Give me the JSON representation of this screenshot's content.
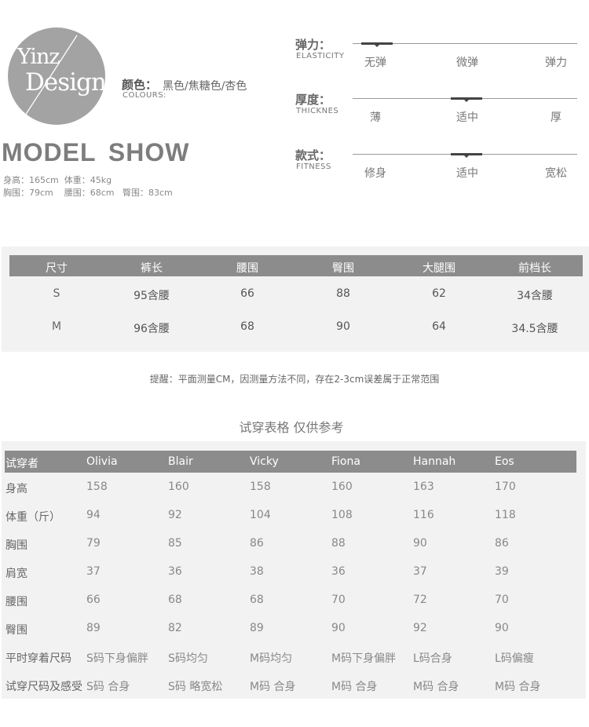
{
  "logo": {
    "line1": "Yinz",
    "line2": "Design"
  },
  "colours": {
    "label": "颜色：",
    "value": "黑色/焦糖色/杏色",
    "label_en": "COLOURS:"
  },
  "model": {
    "title": "MODEL  SHOW",
    "line1": "身高：165cm  体重：45kg",
    "line2": "胸围：79cm    腰围：68cm   臀围：83cm"
  },
  "scales": [
    {
      "label": "弹力：",
      "label_en": "ELASTICITY",
      "options": [
        "无弹",
        "微弹",
        "弹力"
      ],
      "selected_index": 0
    },
    {
      "label": "厚度：",
      "label_en": "THICKNES",
      "options": [
        "薄",
        "适中",
        "厚"
      ],
      "selected_index": 1
    },
    {
      "label": "款式：",
      "label_en": "FITNESS",
      "options": [
        "修身",
        "适中",
        "宽松"
      ],
      "selected_index": 1
    }
  ],
  "size_table": {
    "headers": [
      "尺寸",
      "裤长",
      "腰围",
      "臀围",
      "大腿围",
      "前档长"
    ],
    "rows": [
      [
        "S",
        "95含腰",
        "66",
        "88",
        "62",
        "34含腰"
      ],
      [
        "M",
        "96含腰",
        "68",
        "90",
        "64",
        "34.5含腰"
      ]
    ]
  },
  "note": "提醒：平面测量CM，因测量方法不同，存在2-3cm误差属于正常范围",
  "try_table": {
    "title": "试穿表格 仅供参考",
    "headers": [
      "试穿者",
      "Olivia",
      "Blair",
      "Vicky",
      "Fiona",
      "Hannah",
      "Eos"
    ],
    "rows": [
      [
        "身高",
        "158",
        "160",
        "158",
        "160",
        "163",
        "170"
      ],
      [
        "体重（斤）",
        "94",
        "92",
        "104",
        "108",
        "116",
        "118"
      ],
      [
        "胸围",
        "79",
        "85",
        "86",
        "88",
        "90",
        "86"
      ],
      [
        "肩宽",
        "37",
        "36",
        "38",
        "36",
        "37",
        "39"
      ],
      [
        "腰围",
        "66",
        "68",
        "68",
        "70",
        "72",
        "70"
      ],
      [
        "臀围",
        "89",
        "82",
        "89",
        "90",
        "92",
        "90"
      ],
      [
        "平时穿着尺码",
        "S码下身偏胖",
        "S码均匀",
        "M码均匀",
        "M码下身偏胖",
        "L码合身",
        "L码偏瘦"
      ],
      [
        "试穿尺码及感受",
        "S码 合身",
        "S码 略宽松",
        "M码 合身",
        "M码 合身",
        "M码 合身",
        "M码 合身"
      ]
    ]
  },
  "colors": {
    "header_bg": "#8c8c8c",
    "table_bg": "#f2f2f2",
    "logo_bg": "#a3a3a3"
  }
}
